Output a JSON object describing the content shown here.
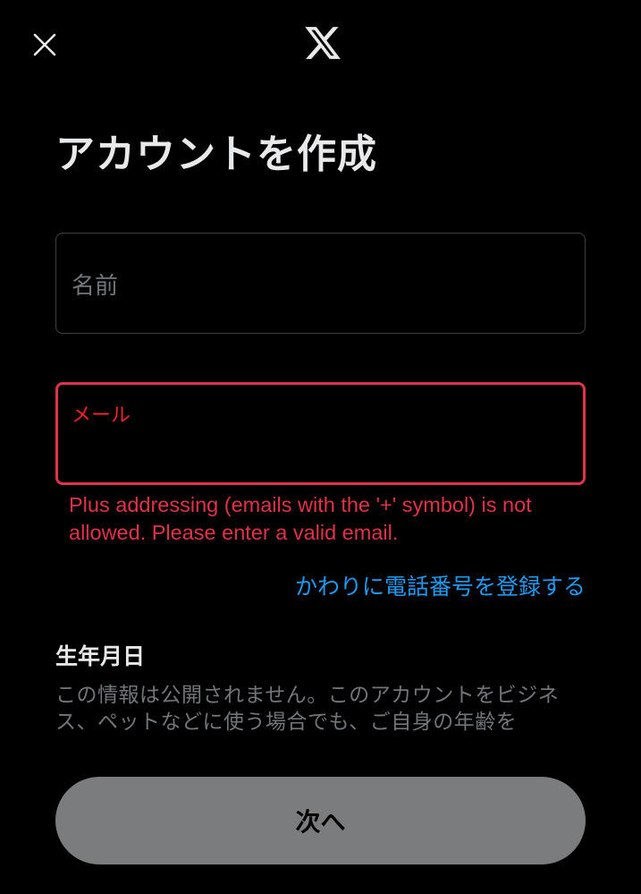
{
  "header": {
    "close_icon": "close-icon",
    "logo_icon": "x-logo-icon"
  },
  "title": "アカウントを作成",
  "form": {
    "name_field": {
      "placeholder": "名前",
      "value": ""
    },
    "email_field": {
      "label": "メール",
      "value": "",
      "error": "Plus addressing (emails with the '+' symbol) is not allowed. Please enter a valid email."
    },
    "phone_link": "かわりに電話番号を登録する"
  },
  "birthday": {
    "heading": "生年月日",
    "description": "この情報は公開されません。このアカウントをビジネス、ペットなどに使う場合でも、ご自身の年齢を"
  },
  "footer": {
    "next_button": "次へ"
  },
  "colors": {
    "background": "#000000",
    "error": "#f4212e",
    "link": "#1d9bf0",
    "text_primary": "#e7e9ea",
    "text_secondary": "#71767b",
    "button_disabled": "#7b7c7e"
  }
}
